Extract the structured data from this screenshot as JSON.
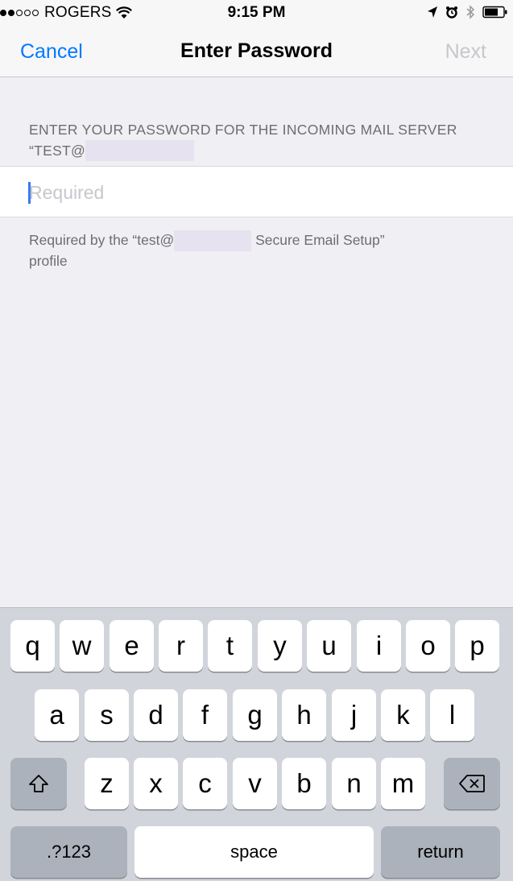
{
  "status_bar": {
    "carrier": "ROGERS",
    "time": "9:15 PM",
    "signal_bars_filled": 2,
    "signal_bars_total": 5,
    "icons": [
      "wifi-icon",
      "location-icon",
      "alarm-icon",
      "bluetooth-icon",
      "battery-icon"
    ]
  },
  "nav": {
    "cancel_label": "Cancel",
    "title": "Enter Password",
    "next_label": "Next"
  },
  "form": {
    "header_line1": "ENTER YOUR PASSWORD FOR THE INCOMING MAIL SERVER",
    "header_line2_prefix": "“TEST@",
    "password_placeholder": "Required",
    "password_value": "",
    "footer_prefix": "Required by the “test@",
    "footer_suffix": "Secure Email Setup”",
    "footer_line2": "profile"
  },
  "keyboard": {
    "row1": [
      "q",
      "w",
      "e",
      "r",
      "t",
      "y",
      "u",
      "i",
      "o",
      "p"
    ],
    "row2": [
      "a",
      "s",
      "d",
      "f",
      "g",
      "h",
      "j",
      "k",
      "l"
    ],
    "row3": [
      "z",
      "x",
      "c",
      "v",
      "b",
      "n",
      "m"
    ],
    "numbers_label": ".?123",
    "space_label": "space",
    "return_label": "return"
  },
  "colors": {
    "accent": "#007aff",
    "disabled": "#c7c7cc",
    "background": "#efeff4",
    "keyboard_bg": "#d1d5db"
  }
}
